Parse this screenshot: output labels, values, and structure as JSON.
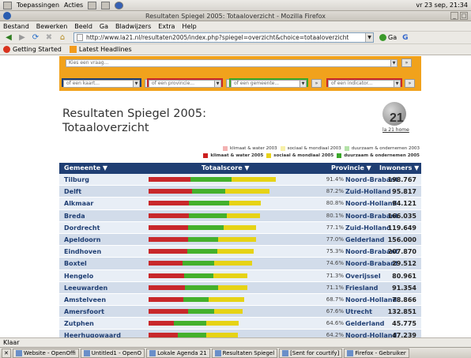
{
  "panel": {
    "apps": "Toepassingen",
    "actions": "Acties",
    "clock": "vr 23 sep, 21:34"
  },
  "window": {
    "title": "Resultaten Spiegel 2005: Totaaloverzicht - Mozilla Firefox"
  },
  "menu": [
    "Bestand",
    "Bewerken",
    "Beeld",
    "Ga",
    "Bladwijzers",
    "Extra",
    "Help"
  ],
  "nav": {
    "url": "http://www.la21.nl/resultaten2005/index.php?spiegel=overzicht&choice=totaaloverzicht",
    "go_label": "Ga",
    "search_icon": "G"
  },
  "bookmarks": [
    "Getting Started",
    "Latest Headlines"
  ],
  "filters": {
    "search": "Kies een vraag...",
    "kaart": "of een kaart...",
    "provincie": "of een provincie...",
    "gemeente": "of een gemeente...",
    "indicator": "of een indicator...",
    "go": "»"
  },
  "page_title": [
    "Resultaten Spiegel 2005:",
    "Totaaloverzicht"
  ],
  "logo": {
    "number": "21",
    "label": "la 21 home"
  },
  "legend": {
    "prev": [
      "klimaat & water 2003",
      "sociaal & mondiaal 2003",
      "duurzaam & ondernemen 2003"
    ],
    "curr": [
      "klimaat & water 2005",
      "sociaal & mondiaal 2005",
      "duurzaam & ondernemen 2005"
    ],
    "colors_prev": [
      "#f3b2b2",
      "#f7f0a8",
      "#b4e2a8"
    ],
    "colors_curr": [
      "#cc1f1f",
      "#e8d21a",
      "#3aa82a"
    ]
  },
  "table": {
    "headers": {
      "gemeente": "Gemeente ▼",
      "score": "Totaalscore ▼",
      "provincie": "Provincie ▼",
      "inwoners": "Inwoners ▼"
    },
    "colors": {
      "red": "#c8282b",
      "green": "#44b02c",
      "yellow": "#e6d316"
    },
    "rows": [
      {
        "name": "Tilburg",
        "pct": "91.4%",
        "province": "Noord-Brabant",
        "inhabitants": "198.767",
        "seg": [
          0.33,
          0.32,
          0.35
        ]
      },
      {
        "name": "Delft",
        "pct": "87.2%",
        "province": "Zuid-Holland",
        "inhabitants": "95.817",
        "seg": [
          0.36,
          0.27,
          0.37
        ]
      },
      {
        "name": "Alkmaar",
        "pct": "80.8%",
        "province": "Noord-Holland",
        "inhabitants": "94.121",
        "seg": [
          0.36,
          0.36,
          0.28
        ]
      },
      {
        "name": "Breda",
        "pct": "80.1%",
        "province": "Noord-Brabant",
        "inhabitants": "166.035",
        "seg": [
          0.36,
          0.34,
          0.3
        ]
      },
      {
        "name": "Dordrecht",
        "pct": "77.1%",
        "province": "Zuid-Holland",
        "inhabitants": "119.649",
        "seg": [
          0.37,
          0.33,
          0.3
        ]
      },
      {
        "name": "Apeldoorn",
        "pct": "77.0%",
        "province": "Gelderland",
        "inhabitants": "156.000",
        "seg": [
          0.37,
          0.28,
          0.35
        ]
      },
      {
        "name": "Eindhoven",
        "pct": "75.3%",
        "province": "Noord-Brabant",
        "inhabitants": "207.870",
        "seg": [
          0.37,
          0.29,
          0.34
        ]
      },
      {
        "name": "Boxtel",
        "pct": "74.6%",
        "province": "Noord-Brabant",
        "inhabitants": "29.512",
        "seg": [
          0.33,
          0.3,
          0.37
        ]
      },
      {
        "name": "Hengelo",
        "pct": "71.3%",
        "province": "Overijssel",
        "inhabitants": "80.961",
        "seg": [
          0.36,
          0.29,
          0.35
        ]
      },
      {
        "name": "Leeuwarden",
        "pct": "71.1%",
        "province": "Friesland",
        "inhabitants": "91.354",
        "seg": [
          0.37,
          0.33,
          0.3
        ]
      },
      {
        "name": "Amstelveen",
        "pct": "68.7%",
        "province": "Noord-Holland",
        "inhabitants": "78.866",
        "seg": [
          0.36,
          0.27,
          0.37
        ]
      },
      {
        "name": "Amersfoort",
        "pct": "67.6%",
        "province": "Utrecht",
        "inhabitants": "132.851",
        "seg": [
          0.42,
          0.28,
          0.3
        ]
      },
      {
        "name": "Zutphen",
        "pct": "64.6%",
        "province": "Gelderland",
        "inhabitants": "45.775",
        "seg": [
          0.28,
          0.36,
          0.36
        ]
      },
      {
        "name": "Heerhugowaard",
        "pct": "64.2%",
        "province": "Noord-Holland",
        "inhabitants": "47.239",
        "seg": [
          0.33,
          0.32,
          0.35
        ]
      }
    ]
  },
  "status": "Klaar",
  "taskbar": [
    "Website - OpenOffi",
    "Untitled1 - OpenO",
    "Lokale Agenda 21",
    "Resultaten Spiegel",
    "[Sent for courtify]",
    "Firefox - Gebruiker"
  ]
}
